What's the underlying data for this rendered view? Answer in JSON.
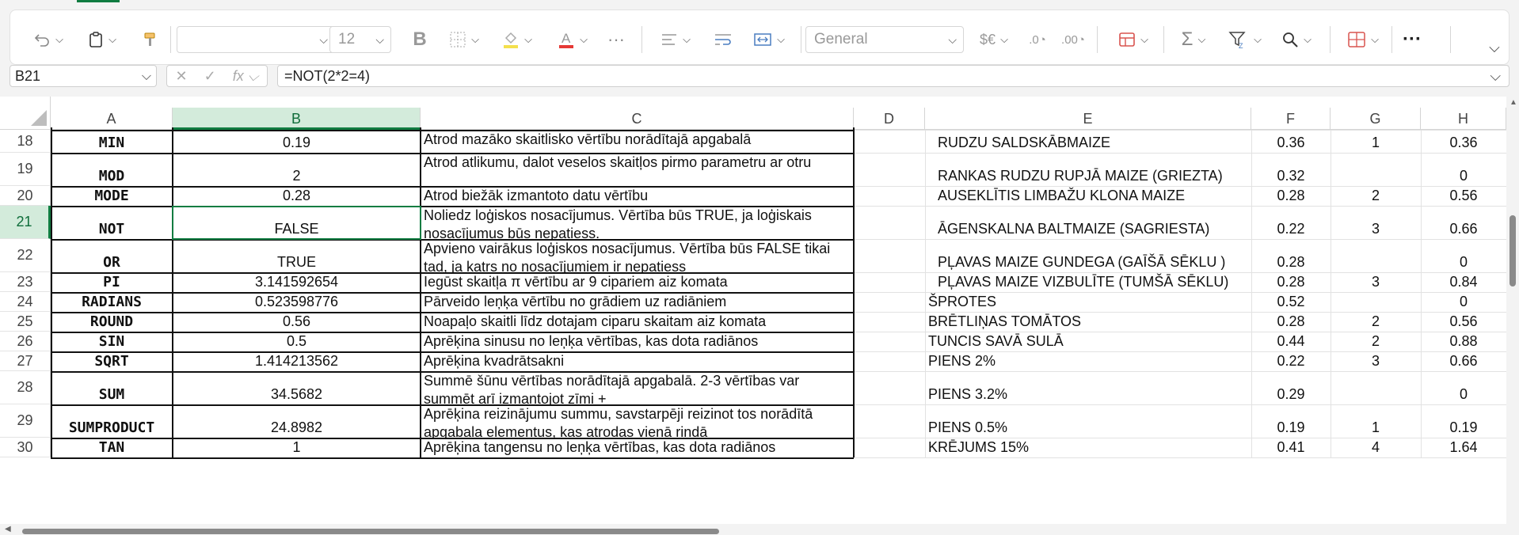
{
  "ribbon": {
    "font_size": "12",
    "number_format": "General",
    "buttons": [
      "undo",
      "paste",
      "format-painter",
      "bold",
      "borders",
      "fill-color",
      "font-color",
      "more",
      "align",
      "wrap",
      "merge",
      "currency",
      "decrease-decimal",
      "increase-decimal",
      "insert",
      "autosum",
      "sort-filter",
      "find",
      "table",
      "more"
    ]
  },
  "formula_bar": {
    "name_box": "B21",
    "formula": "=NOT(2*2=4)"
  },
  "columns": [
    "A",
    "B",
    "C",
    "D",
    "E",
    "F",
    "G",
    "H"
  ],
  "selected_column": "B",
  "selected_row": "21",
  "rows": [
    {
      "num": "18",
      "a": "MIN",
      "b": "0.19",
      "c": "Atrod mazāko skaitlisko vērtību norādītajā apgabalā",
      "e": "RUDZU SALDSKĀBMAIZE",
      "f": "0.36",
      "g": "1",
      "h": "0.36"
    },
    {
      "num": "19",
      "a": "MOD",
      "b": "2",
      "c": "Atrod atlikumu, dalot veselos skaitļos pirmo parametru ar otru",
      "e": "RANKAS RUDZU RUPJĀ MAIZE (GRIEZTA)",
      "f": "0.32",
      "g": "",
      "h": "0"
    },
    {
      "num": "20",
      "a": "MODE",
      "b": "0.28",
      "c": "Atrod biežāk izmantoto datu vērtību",
      "e": "AUSEKLĪTIS LIMBAŽU KLONA MAIZE",
      "f": "0.28",
      "g": "2",
      "h": "0.56"
    },
    {
      "num": "21",
      "a": "NOT",
      "b": "FALSE",
      "c": "Noliedz loģiskos nosacījumus. Vērtība būs TRUE, ja loģiskais nosacījumus būs nepatiess.",
      "e": "ĀGENSKALNA BALTMAIZE (SAGRIESTA)",
      "f": "0.22",
      "g": "3",
      "h": "0.66"
    },
    {
      "num": "22",
      "a": "OR",
      "b": "TRUE",
      "c": "Apvieno vairākus loģiskos nosacījumus. Vērtība būs FALSE tikai tad, ja katrs no nosacījumiem ir nepatiess",
      "e": "PĻAVAS MAIZE GUNDEGA (GAĪŠĀ SĒKLU )",
      "f": "0.28",
      "g": "",
      "h": "0"
    },
    {
      "num": "23",
      "a": "PI",
      "b": "3.141592654",
      "c": "Iegūst skaitļa  π  vērtību ar 9 cipariem aiz komata",
      "e": "PĻAVAS MAIZE VIZBULĪTE (TUMŠĀ SĒKLU)",
      "f": "0.28",
      "g": "3",
      "h": "0.84"
    },
    {
      "num": "24",
      "a": "RADIANS",
      "b": "0.523598776",
      "c": "Pārveido leņķa vērtību no grādiem uz radiāniem",
      "e": "ŠPROTES",
      "f": "0.52",
      "g": "",
      "h": "0"
    },
    {
      "num": "25",
      "a": "ROUND",
      "b": "0.56",
      "c": "Noapaļo skaitli līdz dotajam ciparu skaitam aiz komata",
      "e": "BRĒTLIŅAS TOMĀTOS",
      "f": "0.28",
      "g": "2",
      "h": "0.56"
    },
    {
      "num": "26",
      "a": "SIN",
      "b": "0.5",
      "c": "Aprēķina sinusu no leņķa vērtības, kas dota radiānos",
      "e": "TUNCIS SAVĀ SULĀ",
      "f": "0.44",
      "g": "2",
      "h": "0.88"
    },
    {
      "num": "27",
      "a": "SQRT",
      "b": "1.414213562",
      "c": "Aprēķina kvadrātsakni",
      "e": "PIENS 2%",
      "f": "0.22",
      "g": "3",
      "h": "0.66"
    },
    {
      "num": "28",
      "a": "SUM",
      "b": "34.5682",
      "c": "Summē šūnu vērtības norādītajā apgabalā. 2-3 vērtības var summēt arī izmantojot zīmi +",
      "e": "PIENS 3.2%",
      "f": "0.29",
      "g": "",
      "h": "0"
    },
    {
      "num": "29",
      "a": "SUMPRODUCT",
      "b": "24.8982",
      "c": "Aprēķina reizinājumu summu, savstarpēji reizinot tos norādītā apgabala elementus, kas atrodas vienā rindā",
      "e": "PIENS 0.5%",
      "f": "0.19",
      "g": "1",
      "h": "0.19"
    },
    {
      "num": "30",
      "a": "TAN",
      "b": "1",
      "c": "Aprēķina tangensu no leņķa vērtības, kas dota radiānos",
      "e": "KRĒJUMS 15%",
      "f": "0.41",
      "g": "4",
      "h": "1.64"
    }
  ],
  "colors": {
    "accent": "#107c41",
    "selection_fill": "#d3ebdb"
  }
}
